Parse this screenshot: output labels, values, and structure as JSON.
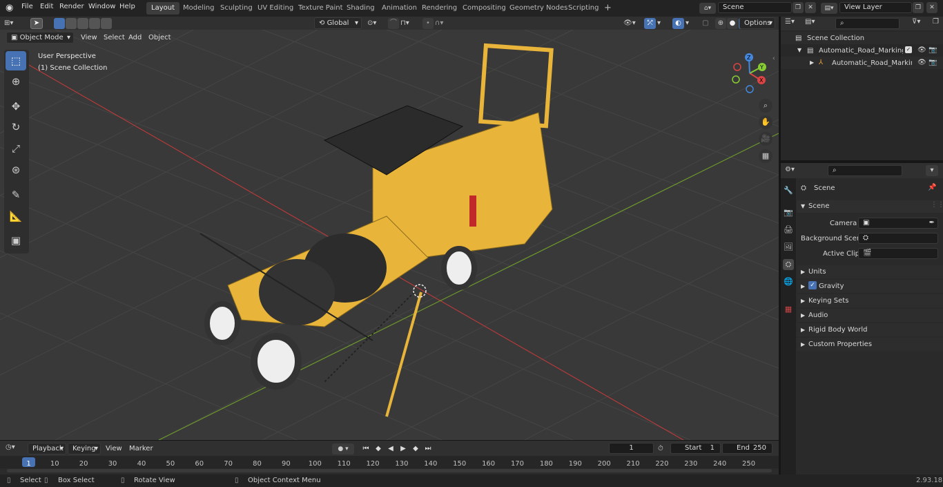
{
  "menu": [
    "File",
    "Edit",
    "Render",
    "Window",
    "Help"
  ],
  "workspaces": [
    "Layout",
    "Modeling",
    "Sculpting",
    "UV Editing",
    "Texture Paint",
    "Shading",
    "Animation",
    "Rendering",
    "Compositing",
    "Geometry Nodes",
    "Scripting"
  ],
  "active_workspace": "Layout",
  "scene_field": "Scene",
  "view_layer_field": "View Layer",
  "viewport": {
    "mode": "Object Mode",
    "header_menus": [
      "View",
      "Select",
      "Add",
      "Object"
    ],
    "transform_orientation": "Global",
    "options_label": "Options",
    "perspective_label": "User Perspective",
    "collection_label": "(1) Scene Collection"
  },
  "outliner": {
    "root": "Scene Collection",
    "items": [
      "Automatic_Road_Marking_Ma",
      "Automatic_Road_Marking"
    ]
  },
  "properties": {
    "context": "Scene",
    "panel_title": "Scene",
    "fields": [
      {
        "label": "Camera",
        "value": ""
      },
      {
        "label": "Background Scene",
        "value": ""
      },
      {
        "label": "Active Clip",
        "value": ""
      }
    ],
    "sections": [
      "Units",
      "Gravity",
      "Keying Sets",
      "Audio",
      "Rigid Body World",
      "Custom Properties"
    ]
  },
  "timeline": {
    "menus": [
      "Playback",
      "Keying",
      "View",
      "Marker"
    ],
    "current_frame": "1",
    "start_label": "Start",
    "start": "1",
    "end_label": "End",
    "end": "250",
    "ticks": [
      "1",
      "10",
      "20",
      "30",
      "40",
      "50",
      "60",
      "70",
      "80",
      "90",
      "100",
      "110",
      "120",
      "130",
      "140",
      "150",
      "160",
      "170",
      "180",
      "190",
      "200",
      "210",
      "220",
      "230",
      "240",
      "250"
    ]
  },
  "status": {
    "select": "Select",
    "box_select": "Box Select",
    "rotate_view": "Rotate View",
    "context_menu": "Object Context Menu",
    "version": "2.93.18"
  },
  "colors": {
    "accent": "#4772b3",
    "machine_yellow": "#e8b53a",
    "x_axis": "#b53a3a",
    "y_axis": "#6e9a2c"
  }
}
